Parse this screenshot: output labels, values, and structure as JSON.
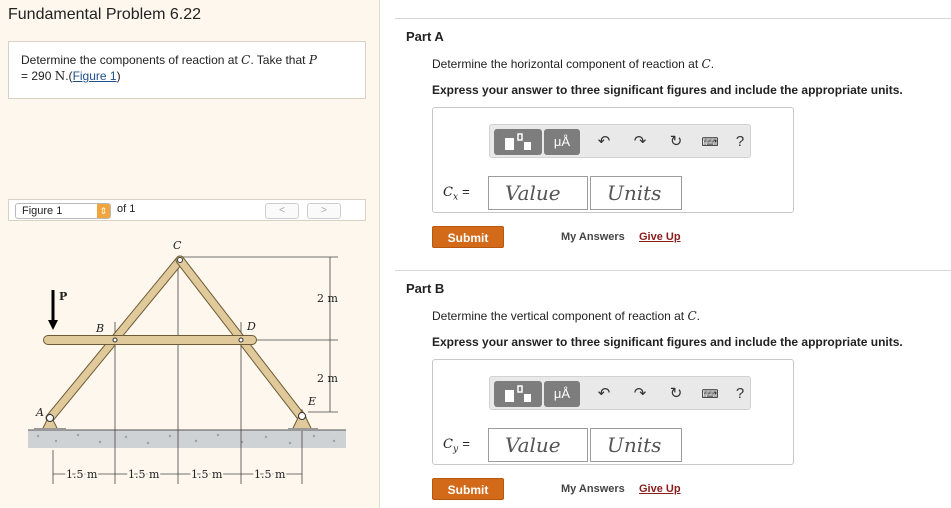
{
  "problem": {
    "title": "Fundamental Problem 6.22",
    "statement_prefix": "Determine the components of reaction at",
    "point": "C",
    "statement_mid": ". Take that",
    "load_var": "P",
    "statement_value": "= 290",
    "unit": "N",
    "statement_sep": ".(",
    "figure_link": "Figure 1",
    "statement_end": ")"
  },
  "figure_nav": {
    "select_value": "Figure 1",
    "of_label": "of 1",
    "prev": "<",
    "next": ">"
  },
  "figure": {
    "labels": {
      "C": "C",
      "B": "B",
      "D": "D",
      "A": "A",
      "E": "E",
      "P": "P"
    },
    "dim_right_top": "2 m",
    "dim_right_bottom": "2 m",
    "dims_bottom": [
      "1.5 m",
      "1.5 m",
      "1.5 m",
      "1.5 m"
    ]
  },
  "toolbar": {
    "templates_icon": "templates-icon",
    "units_button": "μÅ",
    "undo_icon": "undo-icon",
    "redo_icon": "redo-icon",
    "reset_icon": "reset-icon",
    "keyboard_icon": "keyboard-icon",
    "help": "?"
  },
  "parts": [
    {
      "heading": "Part A",
      "question_prefix": "Determine the horizontal component of reaction at",
      "question_point": "C",
      "question_end": ".",
      "instruction": "Express your answer to three significant figures and include the appropriate units.",
      "var_symbol": "C",
      "var_sub": "x",
      "eq": "=",
      "value_placeholder": "Value",
      "units_placeholder": "Units",
      "submit": "Submit",
      "my_answers": "My Answers",
      "give_up": "Give Up"
    },
    {
      "heading": "Part B",
      "question_prefix": "Determine the vertical component of reaction at",
      "question_point": "C",
      "question_end": ".",
      "instruction": "Express your answer to three significant figures and include the appropriate units.",
      "var_symbol": "C",
      "var_sub": "y",
      "eq": "=",
      "value_placeholder": "Value",
      "units_placeholder": "Units",
      "submit": "Submit",
      "my_answers": "My Answers",
      "give_up": "Give Up"
    }
  ],
  "colors": {
    "accent": "#d36a1a",
    "link": "#1f4e8c",
    "give_up": "#8b1c1c",
    "member": "#e0c99a",
    "panel_bg": "#fdf7ee"
  }
}
